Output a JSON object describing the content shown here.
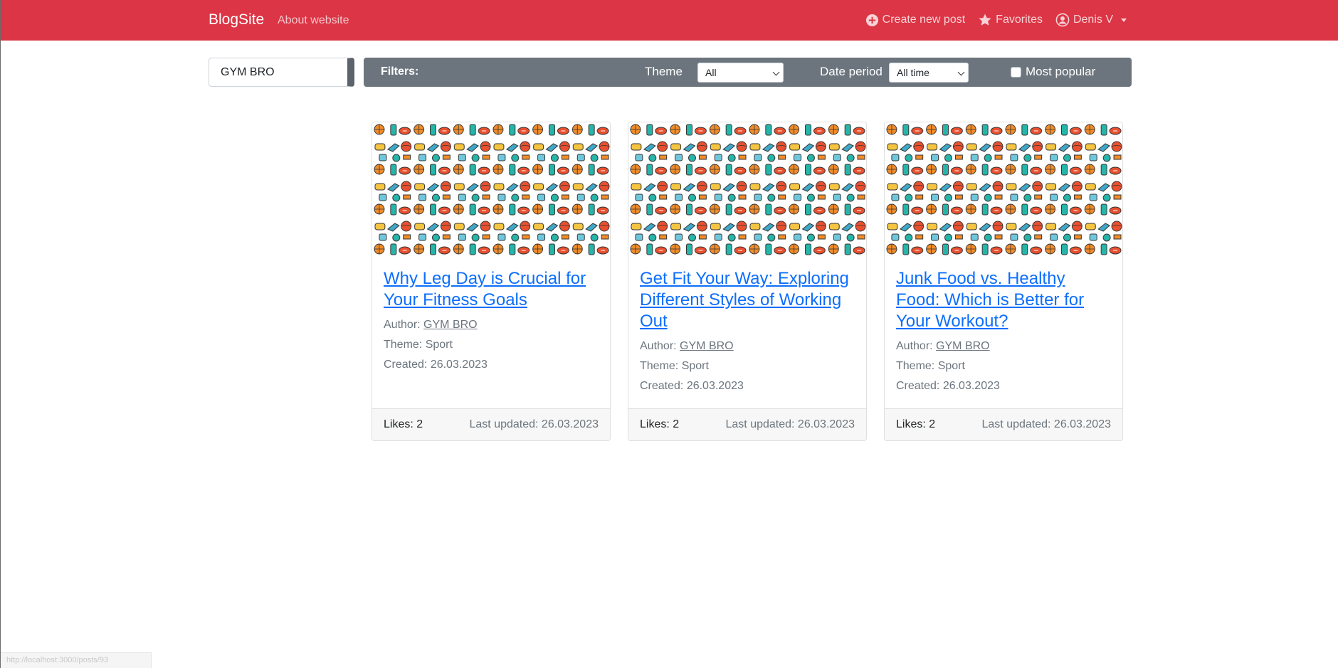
{
  "navbar": {
    "brand": "BlogSite",
    "about": "About website",
    "create": "Create new post",
    "favorites": "Favorites",
    "user": "Denis V",
    "bg_color": "#dc3545"
  },
  "search": {
    "value": "GYM BRO",
    "placeholder": ""
  },
  "filters": {
    "label": "Filters:",
    "theme_label": "Theme",
    "theme_value": "All",
    "date_label": "Date period",
    "date_value": "All time",
    "popular_label": "Most popular",
    "popular_checked": false
  },
  "posts": [
    {
      "title": "Why Leg Day is Crucial for Your Fitness Goals",
      "author_label": "Author:",
      "author": "GYM BRO",
      "theme": "Theme: Sport",
      "created": "Created: 26.03.2023",
      "likes": "Likes: 2",
      "updated": "Last updated: 26.03.2023"
    },
    {
      "title": "Get Fit Your Way: Exploring Different Styles of Working Out",
      "author_label": "Author:",
      "author": "GYM BRO",
      "theme": "Theme: Sport",
      "created": "Created: 26.03.2023",
      "likes": "Likes: 2",
      "updated": "Last updated: 26.03.2023"
    },
    {
      "title": "Junk Food vs. Healthy Food: Which is Better for Your Workout?",
      "author_label": "Author:",
      "author": "GYM BRO",
      "theme": "Theme: Sport",
      "created": "Created: 26.03.2023",
      "likes": "Likes: 2",
      "updated": "Last updated: 26.03.2023"
    }
  ],
  "status_url": "http://localhost:3000/posts/93"
}
